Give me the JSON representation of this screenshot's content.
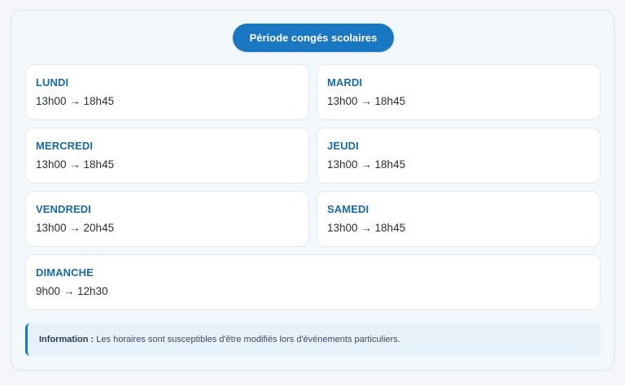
{
  "header": {
    "period_label": "Période congés scolaires"
  },
  "days": [
    {
      "name": "LUNDI",
      "hours": "13h00 → 18h45"
    },
    {
      "name": "MARDI",
      "hours": "13h00 → 18h45"
    },
    {
      "name": "MERCREDI",
      "hours": "13h00 → 18h45"
    },
    {
      "name": "JEUDI",
      "hours": "13h00 → 18h45"
    },
    {
      "name": "VENDREDI",
      "hours": "13h00 → 20h45"
    },
    {
      "name": "SAMEDI",
      "hours": "13h00 → 18h45"
    },
    {
      "name": "DIMANCHE",
      "hours": "9h00 → 12h30"
    }
  ],
  "info": {
    "label": "Information :",
    "text": "Les horaires sont susceptibles d'être modifiés lors d'événements particuliers."
  },
  "colors": {
    "accent": "#1a78c2",
    "day_name": "#1a6aa8",
    "card_bg": "#f3f8fd",
    "info_bg": "#e6f1fa"
  }
}
